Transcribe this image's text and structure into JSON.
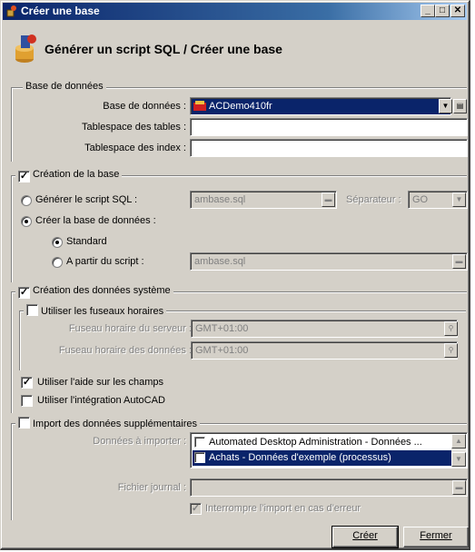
{
  "window": {
    "title": "Créer une base",
    "heading": "Générer un script SQL / Créer une base"
  },
  "base_donnees": {
    "group_title": "Base de données",
    "db_label": "Base de données :",
    "db_value": "ACDemo410fr",
    "tables_label": "Tablespace des tables :",
    "tables_value": "",
    "index_label": "Tablespace des index :",
    "index_value": ""
  },
  "creation_base": {
    "group_title": "Création de la base",
    "checked": true,
    "script_label": "Générer le script SQL :",
    "script_value": "ambase.sql",
    "separateur_label": "Séparateur :",
    "separateur_value": "GO",
    "create_label": "Créer la base de données :",
    "standard_label": "Standard",
    "from_script_label": "A partir du script :",
    "from_script_value": "ambase.sql"
  },
  "donnees_systeme": {
    "group_title": "Création des données système",
    "checked": true,
    "timezone_group_title": "Utiliser les fuseaux horaires",
    "server_tz_label": "Fuseau horaire du serveur :",
    "server_tz_value": "GMT+01:00",
    "data_tz_label": "Fuseau horaire des données :",
    "data_tz_value": "GMT+01:00",
    "field_help_label": "Utiliser l'aide sur les champs",
    "autocad_label": "Utiliser l'intégration AutoCAD"
  },
  "import": {
    "group_title": "Import des données supplémentaires",
    "data_label": "Données à importer :",
    "items": [
      "Automated Desktop Administration - Données ...",
      "Achats - Données d'exemple (processus)"
    ],
    "journal_label": "Fichier journal :",
    "journal_value": "",
    "stop_label": "Interrompre l'import en cas d'erreur"
  },
  "buttons": {
    "create": "Créer",
    "close": "Fermer"
  }
}
